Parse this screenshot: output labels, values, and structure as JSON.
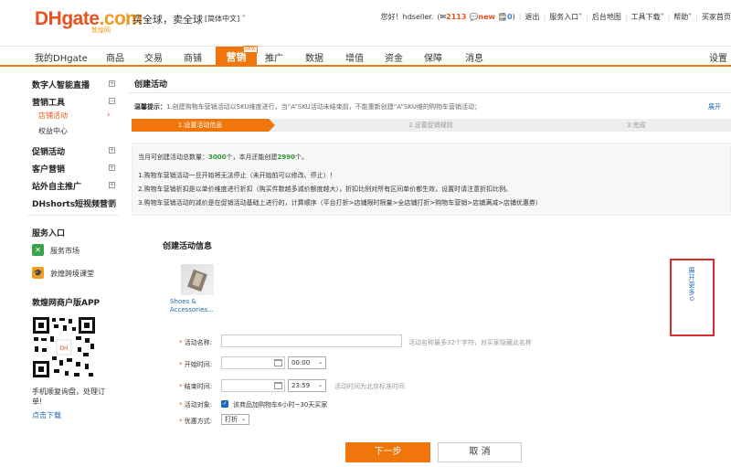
{
  "header": {
    "logo_main": "DHgate",
    "logo_suffix": ".com",
    "logo_sub": "敦煌网",
    "slogan": "买全球，卖全球",
    "language": "[简体中文]",
    "greeting": "您好！",
    "username": "hdseller.",
    "message_count": "2113",
    "new_label": "new",
    "order_count": "0",
    "links": [
      "退出",
      "服务入口",
      "后台地图",
      "工具下载",
      "帮助",
      "买家首页"
    ]
  },
  "nav": {
    "items": [
      "我的DHgate",
      "商品",
      "交易",
      "商铺",
      "营销",
      "推广",
      "数据",
      "增值",
      "资金",
      "保障",
      "消息",
      "设置"
    ],
    "active": "营销",
    "active_badge": "NEW"
  },
  "sidebar": {
    "groups": [
      "数字人智能直播",
      "营销工具",
      "促销活动",
      "客户营销",
      "站外自主推广",
      "DHshorts短视频营销"
    ],
    "sub_items": [
      "店铺活动",
      "权益中心"
    ],
    "service_title": "服务入口",
    "services": [
      "服务市场",
      "敦煌跨境课堂"
    ],
    "app_title": "敦煌网商户版APP",
    "app_desc": "手机顺复询盘，处理订单!",
    "app_link": "点击下载"
  },
  "content": {
    "title": "创建活动",
    "tip_label": "温馨提示：",
    "tip_text": "1.创建购物车营销活动以SKU维度进行，当“A”SKU活动未结束前，不能重新创建“A”SKU维的购物车营销活动；",
    "expand_label": "展开",
    "steps": [
      "1.设置活动信息",
      "2.设置促销规则",
      "3.完成"
    ],
    "quota_prefix": "当月可创建活动总数量：",
    "quota_total": "3000",
    "quota_mid": "个，本月还能创建",
    "quota_remain": "2990",
    "quota_suffix": "个。",
    "notes": [
      "1.购物车营销活动一旦开始将无法停止（未开始前可以修改、停止）！",
      "2.购物车营销折扣是以单价维度进行折扣（购买件数越多减价额度越大），折扣比例对所有区间单价都生效，设置时请注意折扣比例。",
      "3.购物车营销活动的减价是在促销活动基础上进行的，计算顺序（平台打折>店铺限时限量>全店铺打折>购物车营销>店铺满减>店铺优惠券）"
    ],
    "form_title": "创建活动信息",
    "product_label": "Shoes & Accessories...",
    "more_label": "展开更多⊙",
    "fields": {
      "name_label": "活动名称:",
      "name_value": "",
      "name_hint": "活动名称最多32个字符，对买家隐藏此名称",
      "start_label": "开始时间:",
      "start_date": "",
      "start_time": "00:00",
      "end_label": "结束时间:",
      "end_date": "",
      "end_time": "23:59",
      "time_hint": "活动时间为北京标准时间",
      "target_label": "活动对象:",
      "target_option": "该商品加购物车6小时~30天买家",
      "discount_label": "优惠方式:",
      "discount_value": "打折"
    },
    "next_button": "下一步",
    "cancel_button": "取 消"
  }
}
